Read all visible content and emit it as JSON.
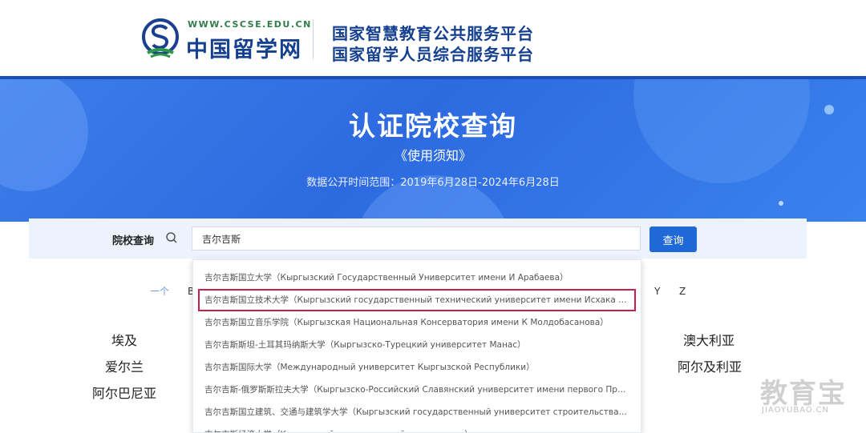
{
  "header": {
    "logo_url": "WWW.CSCSE.EDU.CN",
    "logo_name": "中国留学网",
    "platform_line1": "国家智慧教育公共服务平台",
    "platform_line2": "国家留学人员综合服务平台"
  },
  "banner": {
    "title": "认证院校查询",
    "notice_link": "《使用须知》",
    "date_range": "数据公开时间范围：2019年6月28日-2024年6月28日"
  },
  "search": {
    "label": "院校查询",
    "value": "吉尔吉斯",
    "button_label": "查询"
  },
  "letter_filter": {
    "all_label": "一个",
    "letters": [
      "B",
      "Y",
      "Z"
    ]
  },
  "countries": {
    "left": [
      "埃及",
      "爱尔兰",
      "阿尔巴尼亚"
    ],
    "right": [
      "澳大利亚",
      "阿尔及利亚"
    ]
  },
  "dropdown": {
    "items": [
      "吉尔吉斯国立大学（Кыргызский Государственный Университет имени И Арабаева）",
      "吉尔吉斯国立技术大学（Кыргызский государственный технический университет имени Исхака Раззакова）",
      "吉尔吉斯国立音乐学院（Кыргызская Национальная Консерватория имени К Молдобасанова）",
      "吉尔吉斯斯坦-土耳其玛纳斯大学（Кыргызско-Турецкий университет Манас）",
      "吉尔吉斯国际大学（Международный университет Кыргызской Республики）",
      "吉尔吉斯-俄罗斯斯拉夫大学（Кыргызско-Российский Славянский университет имени первого Президента）",
      "吉尔吉斯国立建筑、交通与建筑学大学（Кыргызский государственный университет строительства, транспорта и архитектуры）",
      "吉尔吉斯经济大学（Кыргызский экономический университет）"
    ],
    "highlighted_index": 1
  },
  "watermark": {
    "text": "教育宝",
    "url": "JIAOYUBAO.CN"
  },
  "colors": {
    "brand_blue": "#15408f",
    "banner_blue": "#2d6ae0",
    "button_blue": "#1f68d8",
    "highlight_red": "#c81e4b"
  }
}
